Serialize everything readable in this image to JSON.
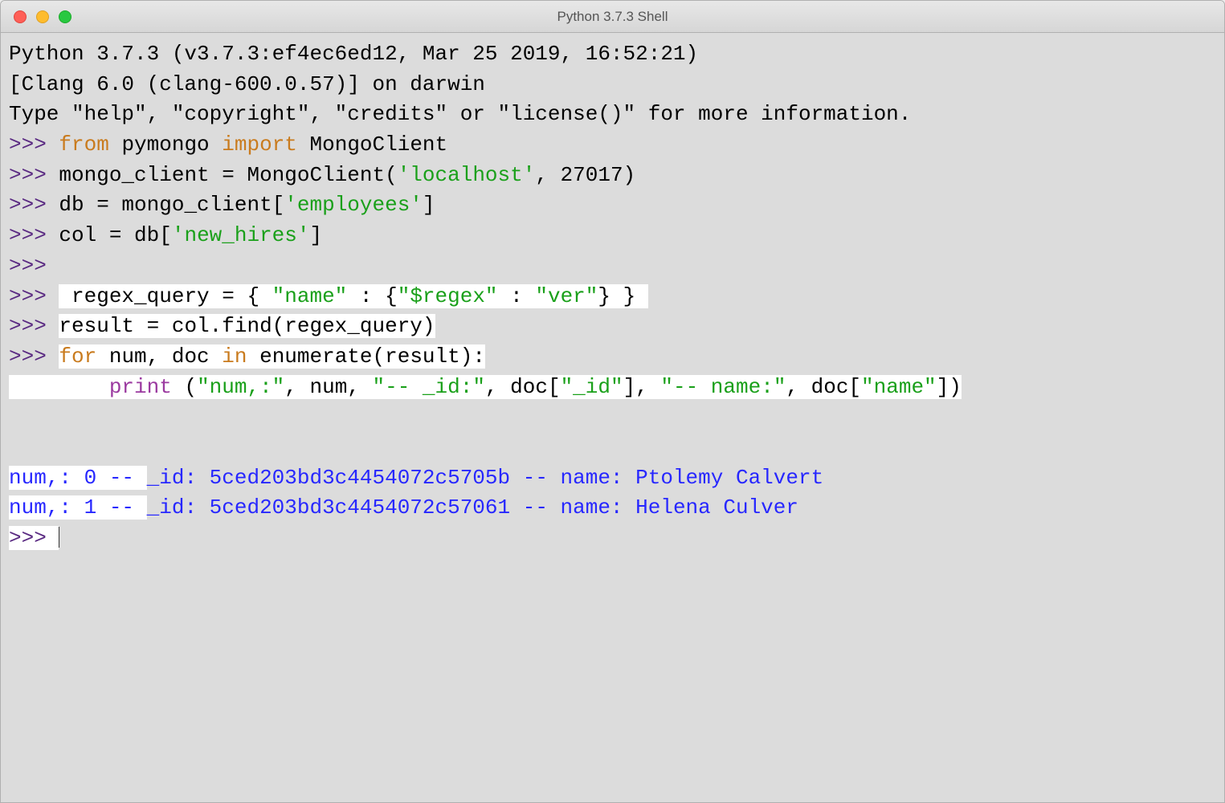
{
  "window": {
    "title": "Python 3.7.3 Shell"
  },
  "code": {
    "banner1": "Python 3.7.3 (v3.7.3:ef4ec6ed12, Mar 25 2019, 16:52:21) ",
    "banner2": "[Clang 6.0 (clang-600.0.57)] on darwin",
    "banner3": "Type \"help\", \"copyright\", \"credits\" or \"license()\" for more information.",
    "prompt": ">>> ",
    "kw_from": "from",
    "kw_import": "import",
    "line1_a": " pymongo ",
    "line1_b": " MongoClient",
    "line2_a": "mongo_client = MongoClient(",
    "line2_str": "'localhost'",
    "line2_b": ", 27017)",
    "line3_a": "db = mongo_client[",
    "line3_str": "'employees'",
    "line3_b": "]",
    "line4_a": "col = db[",
    "line4_str": "'new_hires'",
    "line4_b": "]",
    "line6_a": " regex_query = { ",
    "line6_s1": "\"name\"",
    "line6_b": " : {",
    "line6_s2": "\"$regex\"",
    "line6_c": " : ",
    "line6_s3": "\"ver\"",
    "line6_d": "} } ",
    "line7": "result = col.find(regex_query)",
    "kw_for": "for",
    "line8_a": " num, doc ",
    "kw_in": "in",
    "line8_b": " enumerate(result):",
    "line9_indent": "        ",
    "kw_print": "print",
    "line9_a": " (",
    "line9_s1": "\"num,:\"",
    "line9_b": ", num, ",
    "line9_s2": "\"-- _id:\"",
    "line9_c": ", doc[",
    "line9_s3": "\"_id\"",
    "line9_d": "], ",
    "line9_s4": "\"-- name:\"",
    "line9_e": ", doc[",
    "line9_s5": "\"name\"",
    "line9_f": "])",
    "out1": "num,: 0 -- ",
    "out1b": "_id: 5ced203bd3c4454072c5705b -- name: Ptolemy Calvert",
    "out2": "num,: 1 -- ",
    "out2b": "_id: 5ced203bd3c4454072c57061 -- name: Helena Culver",
    "final_prompt": ">>> "
  }
}
